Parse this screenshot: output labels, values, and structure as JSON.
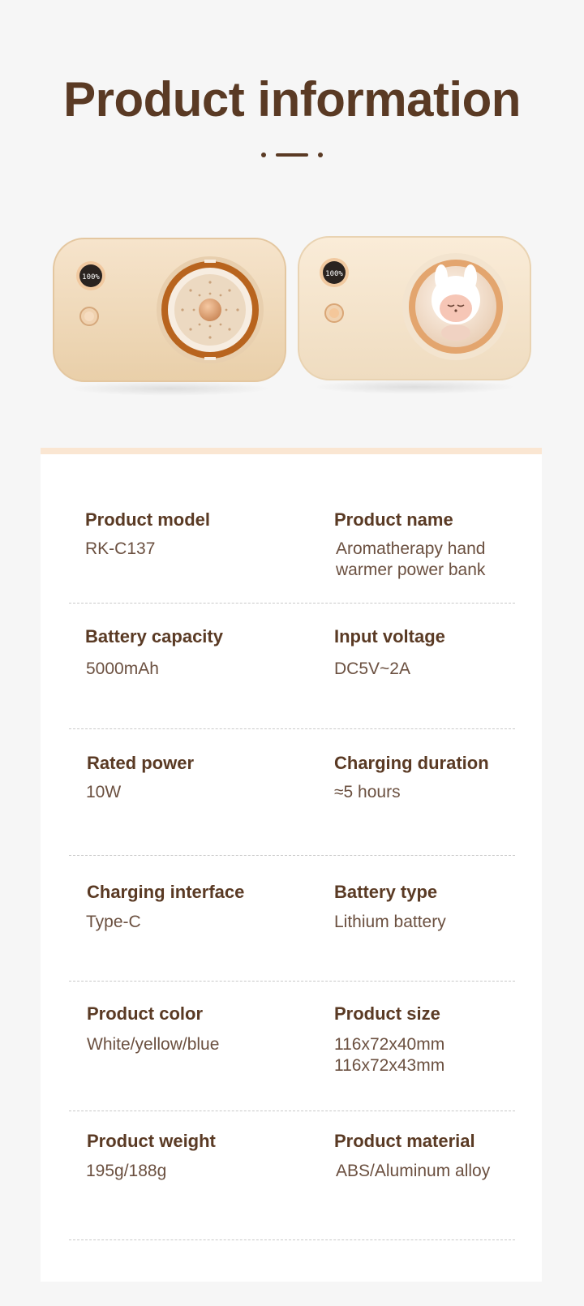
{
  "page": {
    "title": "Product information"
  },
  "device_left": {
    "display": "100%",
    "colors": {
      "body": "#f2dcc0",
      "accent": "#b8641e"
    }
  },
  "device_right": {
    "display": "100%",
    "colors": {
      "body": "#f6e6cf",
      "ring": "#e3a56e"
    }
  },
  "specs": [
    {
      "label": "Product model",
      "value": "RK-C137"
    },
    {
      "label": "Product name",
      "value": "Aromatherapy hand\nwarmer power bank"
    },
    {
      "label": "Battery capacity",
      "value": "5000mAh"
    },
    {
      "label": "Input voltage",
      "value": "DC5V~2A"
    },
    {
      "label": "Rated power",
      "value": "10W"
    },
    {
      "label": "Charging duration",
      "value": "≈5 hours"
    },
    {
      "label": "Charging interface",
      "value": "Type-C"
    },
    {
      "label": "Battery type",
      "value": "Lithium battery"
    },
    {
      "label": "Product color",
      "value": "White/yellow/blue"
    },
    {
      "label": "Product size",
      "value": "116x72x40mm\n116x72x43mm"
    },
    {
      "label": "Product weight",
      "value": "195g/188g"
    },
    {
      "label": "Product material",
      "value": "ABS/Aluminum alloy"
    }
  ],
  "colors": {
    "heading": "#5a3a24",
    "card_border": "#fae6d2",
    "background": "#f6f6f6"
  }
}
